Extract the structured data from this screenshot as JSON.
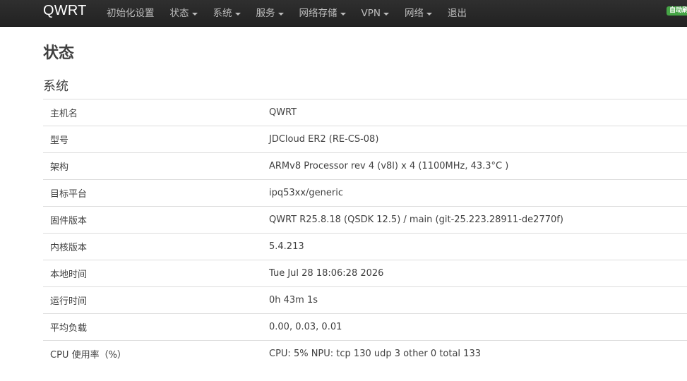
{
  "navbar": {
    "brand": "QWRT",
    "items": [
      {
        "label": "初始化设置",
        "dropdown": false
      },
      {
        "label": "状态",
        "dropdown": true
      },
      {
        "label": "系统",
        "dropdown": true
      },
      {
        "label": "服务",
        "dropdown": true
      },
      {
        "label": "网络存储",
        "dropdown": true
      },
      {
        "label": "VPN",
        "dropdown": true
      },
      {
        "label": "网络",
        "dropdown": true
      },
      {
        "label": "退出",
        "dropdown": false
      }
    ],
    "badge": "自动刷",
    "badge_color": "#46a546"
  },
  "page": {
    "title": "状态",
    "section_title": "系统"
  },
  "system_rows": [
    {
      "label": "主机名",
      "value": "QWRT"
    },
    {
      "label": "型号",
      "value": "JDCloud ER2 (RE-CS-08)"
    },
    {
      "label": "架构",
      "value": "ARMv8 Processor rev 4 (v8l) x 4 (1100MHz, 43.3°C )"
    },
    {
      "label": "目标平台",
      "value": "ipq53xx/generic"
    },
    {
      "label": "固件版本",
      "value": "QWRT R25.8.18 (QSDK 12.5) / main (git-25.223.28911-de2770f)"
    },
    {
      "label": "内核版本",
      "value": "5.4.213"
    },
    {
      "label": "本地时间",
      "value": "Tue Jul 28 18:06:28 2026"
    },
    {
      "label": "运行时间",
      "value": "0h 43m 1s"
    },
    {
      "label": "平均负载",
      "value": "0.00, 0.03, 0.01"
    },
    {
      "label": "CPU 使用率（%）",
      "value": "CPU: 5% NPU: tcp 130 udp 3 other 0 total 133"
    }
  ]
}
